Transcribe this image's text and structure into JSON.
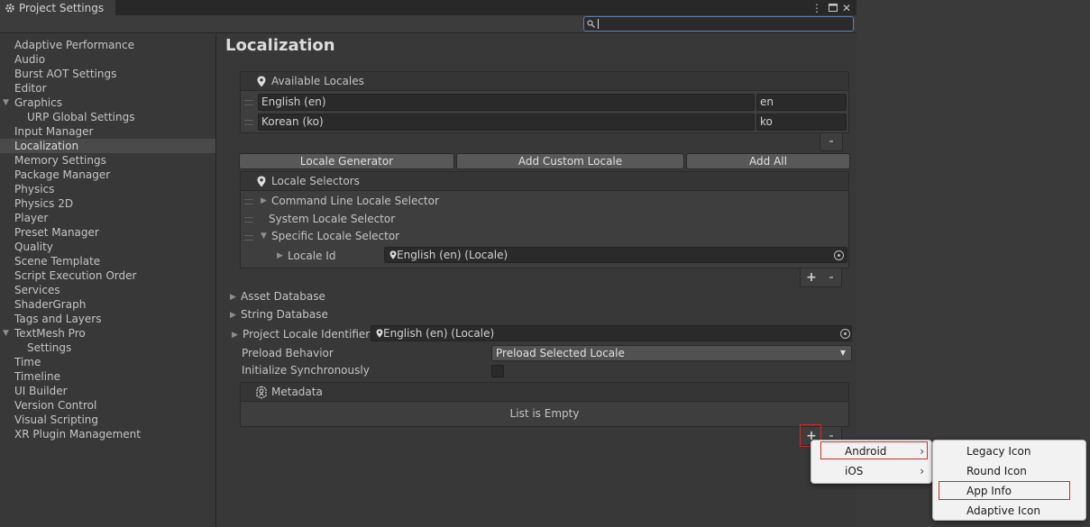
{
  "window": {
    "tab_title": "Project Settings",
    "search_placeholder": "",
    "icons": {
      "tab": "gear-icon",
      "more": "kebab-menu-icon",
      "maximize": "maximize-icon",
      "close": "close-icon",
      "search": "search-icon"
    }
  },
  "sidebar": {
    "items": [
      {
        "label": "Adaptive Performance"
      },
      {
        "label": "Audio"
      },
      {
        "label": "Burst AOT Settings"
      },
      {
        "label": "Editor"
      },
      {
        "label": "Graphics",
        "expanded": true
      },
      {
        "label": "URP Global Settings",
        "child": true
      },
      {
        "label": "Input Manager"
      },
      {
        "label": "Localization",
        "selected": true
      },
      {
        "label": "Memory Settings"
      },
      {
        "label": "Package Manager"
      },
      {
        "label": "Physics"
      },
      {
        "label": "Physics 2D"
      },
      {
        "label": "Player"
      },
      {
        "label": "Preset Manager"
      },
      {
        "label": "Quality"
      },
      {
        "label": "Scene Template"
      },
      {
        "label": "Script Execution Order"
      },
      {
        "label": "Services"
      },
      {
        "label": "ShaderGraph"
      },
      {
        "label": "Tags and Layers"
      },
      {
        "label": "TextMesh Pro",
        "expanded": true
      },
      {
        "label": "Settings",
        "child": true
      },
      {
        "label": "Time"
      },
      {
        "label": "Timeline"
      },
      {
        "label": "UI Builder"
      },
      {
        "label": "Version Control"
      },
      {
        "label": "Visual Scripting"
      },
      {
        "label": "XR Plugin Management"
      }
    ]
  },
  "main": {
    "title": "Localization",
    "available_locales": {
      "header": "Available Locales",
      "rows": [
        {
          "name": "English (en)",
          "code": "en"
        },
        {
          "name": "Korean (ko)",
          "code": "ko"
        }
      ],
      "remove_label": "-"
    },
    "buttons": {
      "locale_generator": "Locale Generator",
      "add_custom_locale": "Add Custom Locale",
      "add_all": "Add All"
    },
    "locale_selectors": {
      "header": "Locale Selectors",
      "items": [
        "Command Line Locale Selector",
        "System Locale Selector",
        "Specific Locale Selector"
      ],
      "locale_id_label": "Locale Id",
      "locale_id_value": "English (en) (Locale)",
      "add_label": "+",
      "remove_label": "-"
    },
    "asset_database": "Asset Database",
    "string_database": "String Database",
    "project_locale_identifier": {
      "label": "Project Locale Identifier",
      "value": "English (en) (Locale)"
    },
    "preload_behavior": {
      "label": "Preload Behavior",
      "value": "Preload Selected Locale"
    },
    "initialize_synchronously": {
      "label": "Initialize Synchronously",
      "checked": false
    },
    "metadata": {
      "header": "Metadata",
      "empty_text": "List is Empty",
      "add_label": "+",
      "remove_label": "-"
    }
  },
  "context_menu": {
    "items": [
      {
        "label": "Android",
        "has_submenu": true,
        "highlighted": true
      },
      {
        "label": "iOS",
        "has_submenu": true
      }
    ],
    "submenu": {
      "items": [
        {
          "label": "Legacy Icon"
        },
        {
          "label": "Round Icon"
        },
        {
          "label": "App Info",
          "highlighted": true
        },
        {
          "label": "Adaptive Icon"
        }
      ]
    },
    "chevron": "›"
  },
  "colors": {
    "background": "#383838",
    "highlight_outline": "#d42a2a",
    "menu_background": "#f2f2f2",
    "search_focus": "#5b7fae"
  }
}
